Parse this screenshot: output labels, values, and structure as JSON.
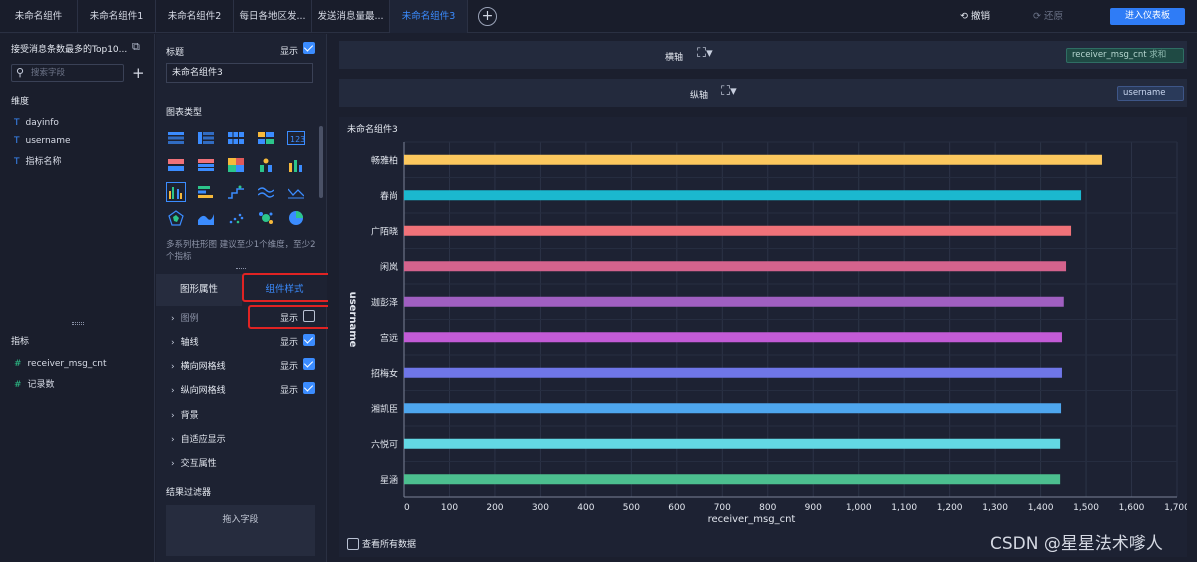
{
  "tabs": [
    "未命名组件",
    "未命名组件1",
    "未命名组件2",
    "每日各地区发...",
    "发送消息量最...",
    "未命名组件3"
  ],
  "active_tab": 5,
  "toolbar": {
    "undo": "撤销",
    "redo": "还原",
    "enter_dashboard": "进入仪表板"
  },
  "left": {
    "dataset": "接受消息条数最多的Top10...",
    "search_placeholder": "搜索字段",
    "dimensions_title": "维度",
    "dimensions": [
      "dayinfo",
      "username",
      "指标名称"
    ],
    "measures_title": "指标",
    "measures": [
      "receiver_msg_cnt",
      "记录数"
    ]
  },
  "mid": {
    "title_label": "标题",
    "show": "显示",
    "title_value": "未命名组件3",
    "chart_type_label": "图表类型",
    "hint": "多系列柱形图 建议至少1个维度，至少2个指标",
    "tab_graph": "图形属性",
    "tab_style": "组件样式",
    "props": [
      "图例",
      "轴线",
      "横向网格线",
      "纵向网格线",
      "背景",
      "自适应显示",
      "交互属性"
    ],
    "filter_title": "结果过滤器",
    "drop_hint": "拖入字段"
  },
  "axes": {
    "x_label": "横轴",
    "y_label": "纵轴",
    "x_field": "receiver_msg_cnt",
    "x_agg": "求和",
    "y_field": "username"
  },
  "chart_title": "未命名组件3",
  "view_all": "查看所有数据",
  "watermark": "CSDN @星星法术嗲人",
  "chart_data": {
    "type": "bar",
    "orientation": "horizontal",
    "categories": [
      "畅雅柏",
      "春尚",
      "广陌晓",
      "闲岚",
      "迦彭泽",
      "宫远",
      "招梅女",
      "湘凯臣",
      "六悦可",
      "星涵"
    ],
    "values": [
      1535,
      1489,
      1467,
      1456,
      1451,
      1447,
      1447,
      1445,
      1443,
      1443
    ],
    "colors": [
      "#fcc85e",
      "#1bb8cf",
      "#f07279",
      "#d4638d",
      "#a05fc1",
      "#c25bd6",
      "#6f76e8",
      "#4ea6ee",
      "#63d8e4",
      "#4cbf8f"
    ],
    "xlabel": "receiver_msg_cnt",
    "ylabel": "username",
    "xlim": [
      0,
      1700
    ],
    "xticks": [
      "0",
      "100",
      "200",
      "300",
      "400",
      "500",
      "600",
      "700",
      "800",
      "900",
      "1,000",
      "1,100",
      "1,200",
      "1,300",
      "1,400",
      "1,500",
      "1,600",
      "1,700"
    ],
    "grid": true
  }
}
